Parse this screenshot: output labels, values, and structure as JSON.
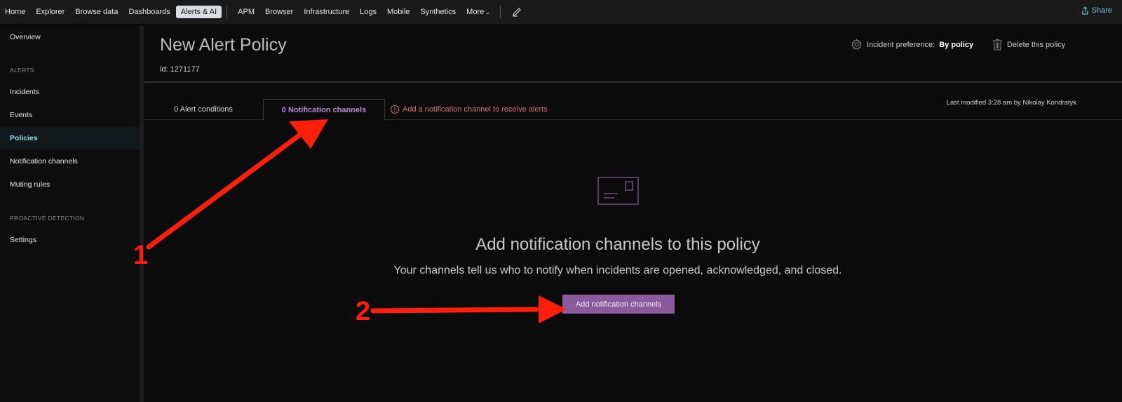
{
  "nav": {
    "items": [
      "Home",
      "Explorer",
      "Browse data",
      "Dashboards",
      "Alerts & AI",
      "APM",
      "Browser",
      "Infrastructure",
      "Logs",
      "Mobile",
      "Synthetics",
      "More"
    ],
    "share": "Share"
  },
  "sidebar": {
    "overview": "Overview",
    "alerts_section": "ALERTS",
    "incidents": "Incidents",
    "events": "Events",
    "policies": "Policies",
    "notification_channels": "Notification channels",
    "muting_rules": "Muting rules",
    "proactive_section": "PROACTIVE DETECTION",
    "settings": "Settings"
  },
  "header": {
    "title": "New Alert Policy",
    "id": "id: 1271177",
    "incident_pref_label": "Incident preference:",
    "incident_pref_value": "By policy",
    "delete": "Delete this policy"
  },
  "tabs": {
    "alert_conditions": "0 Alert conditions",
    "notification_channels": "0 Notification channels",
    "warning": "Add a notification channel to receive alerts",
    "last_modified": "Last modified 3:28 am by Nikolay Kondratyk"
  },
  "empty_state": {
    "title": "Add notification channels to this policy",
    "description": "Your channels tell us who to notify when incidents are opened, acknowledged, and closed.",
    "button": "Add notification channels"
  },
  "annotations": {
    "one": "1",
    "two": "2"
  },
  "colors": {
    "accent_teal": "#8fdce8",
    "accent_purple": "#b58ad6",
    "button_purple": "#8a5a9c",
    "warning_red": "#e06b72",
    "arrow_red": "#ff1f0a"
  }
}
